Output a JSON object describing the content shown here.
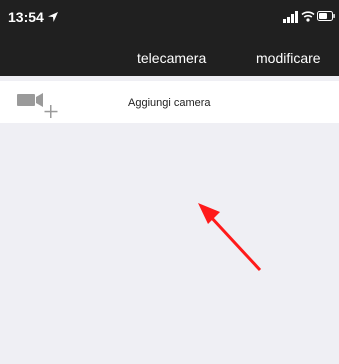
{
  "status_bar": {
    "time": "13:54",
    "icons": [
      "location-arrow-icon",
      "signal-bars-icon",
      "wifi-icon",
      "battery-icon"
    ]
  },
  "nav": {
    "title": "telecamera",
    "edit_label": "modificare"
  },
  "list": {
    "add_camera_label": "Aggiungi camera",
    "add_camera_icon": "add-video-camera-icon"
  },
  "annotation": {
    "arrow_color": "#ff1a1a"
  },
  "colors": {
    "bar_background": "#202020",
    "content_background": "#efeff4",
    "row_background": "#ffffff"
  }
}
